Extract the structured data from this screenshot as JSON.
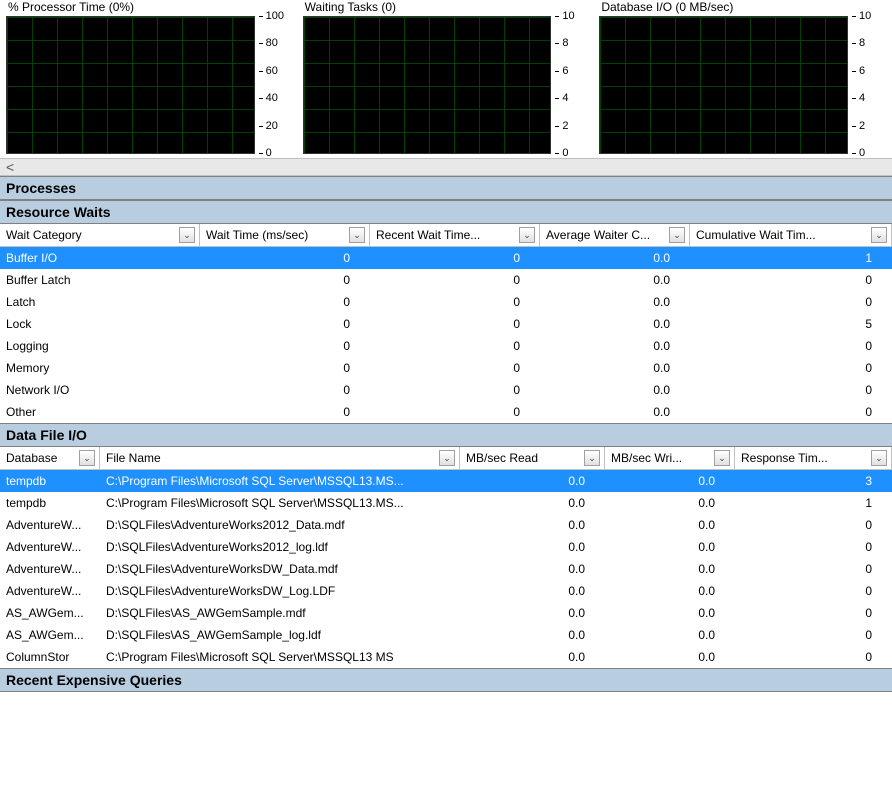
{
  "charts": [
    {
      "title": "% Processor Time (0%)",
      "ticks": [
        "100",
        "80",
        "60",
        "40",
        "20",
        "0"
      ]
    },
    {
      "title": "Waiting Tasks (0)",
      "ticks": [
        "10",
        "8",
        "6",
        "4",
        "2",
        "0"
      ]
    },
    {
      "title": "Database I/O (0 MB/sec)",
      "ticks": [
        "10",
        "8",
        "6",
        "4",
        "2",
        "0"
      ]
    }
  ],
  "chart_data": [
    {
      "type": "line",
      "title": "% Processor Time (0%)",
      "ylabel": "",
      "xlabel": "",
      "ylim": [
        0,
        100
      ],
      "x": [],
      "series": [
        {
          "name": "% Processor Time",
          "values": []
        }
      ]
    },
    {
      "type": "line",
      "title": "Waiting Tasks (0)",
      "ylabel": "",
      "xlabel": "",
      "ylim": [
        0,
        10
      ],
      "x": [],
      "series": [
        {
          "name": "Waiting Tasks",
          "values": []
        }
      ]
    },
    {
      "type": "line",
      "title": "Database I/O (0 MB/sec)",
      "ylabel": "",
      "xlabel": "",
      "ylim": [
        0,
        10
      ],
      "x": [],
      "series": [
        {
          "name": "MB/sec",
          "values": []
        }
      ]
    }
  ],
  "scroll_glyph": "<",
  "sections": {
    "processes": "Processes",
    "resource_waits": "Resource Waits",
    "data_file_io": "Data File I/O",
    "recent_expensive": "Recent Expensive Queries"
  },
  "resource_waits": {
    "columns": [
      "Wait Category",
      "Wait Time (ms/sec)",
      "Recent Wait Time...",
      "Average Waiter C...",
      "Cumulative Wait Tim..."
    ],
    "rows": [
      {
        "cat": "Buffer I/O",
        "wait": "0",
        "recent": "0",
        "avg": "0.0",
        "cum": "1",
        "selected": true
      },
      {
        "cat": "Buffer Latch",
        "wait": "0",
        "recent": "0",
        "avg": "0.0",
        "cum": "0"
      },
      {
        "cat": "Latch",
        "wait": "0",
        "recent": "0",
        "avg": "0.0",
        "cum": "0"
      },
      {
        "cat": "Lock",
        "wait": "0",
        "recent": "0",
        "avg": "0.0",
        "cum": "5"
      },
      {
        "cat": "Logging",
        "wait": "0",
        "recent": "0",
        "avg": "0.0",
        "cum": "0"
      },
      {
        "cat": "Memory",
        "wait": "0",
        "recent": "0",
        "avg": "0.0",
        "cum": "0"
      },
      {
        "cat": "Network I/O",
        "wait": "0",
        "recent": "0",
        "avg": "0.0",
        "cum": "0"
      },
      {
        "cat": "Other",
        "wait": "0",
        "recent": "0",
        "avg": "0.0",
        "cum": "0"
      }
    ]
  },
  "data_file_io": {
    "columns": [
      "Database",
      "File Name",
      "MB/sec Read",
      "MB/sec Wri...",
      "Response Tim..."
    ],
    "rows": [
      {
        "db": "tempdb",
        "file": "C:\\Program Files\\Microsoft SQL Server\\MSSQL13.MS...",
        "read": "0.0",
        "write": "0.0",
        "resp": "3",
        "selected": true
      },
      {
        "db": "tempdb",
        "file": "C:\\Program Files\\Microsoft SQL Server\\MSSQL13.MS...",
        "read": "0.0",
        "write": "0.0",
        "resp": "1"
      },
      {
        "db": "AdventureW...",
        "file": "D:\\SQLFiles\\AdventureWorks2012_Data.mdf",
        "read": "0.0",
        "write": "0.0",
        "resp": "0"
      },
      {
        "db": "AdventureW...",
        "file": "D:\\SQLFiles\\AdventureWorks2012_log.ldf",
        "read": "0.0",
        "write": "0.0",
        "resp": "0"
      },
      {
        "db": "AdventureW...",
        "file": "D:\\SQLFiles\\AdventureWorksDW_Data.mdf",
        "read": "0.0",
        "write": "0.0",
        "resp": "0"
      },
      {
        "db": "AdventureW...",
        "file": "D:\\SQLFiles\\AdventureWorksDW_Log.LDF",
        "read": "0.0",
        "write": "0.0",
        "resp": "0"
      },
      {
        "db": "AS_AWGem...",
        "file": "D:\\SQLFiles\\AS_AWGemSample.mdf",
        "read": "0.0",
        "write": "0.0",
        "resp": "0"
      },
      {
        "db": "AS_AWGem...",
        "file": "D:\\SQLFiles\\AS_AWGemSample_log.ldf",
        "read": "0.0",
        "write": "0.0",
        "resp": "0"
      },
      {
        "db": "ColumnStor",
        "file": "C:\\Program Files\\Microsoft SQL Server\\MSSQL13 MS",
        "read": "0.0",
        "write": "0.0",
        "resp": "0"
      }
    ]
  }
}
